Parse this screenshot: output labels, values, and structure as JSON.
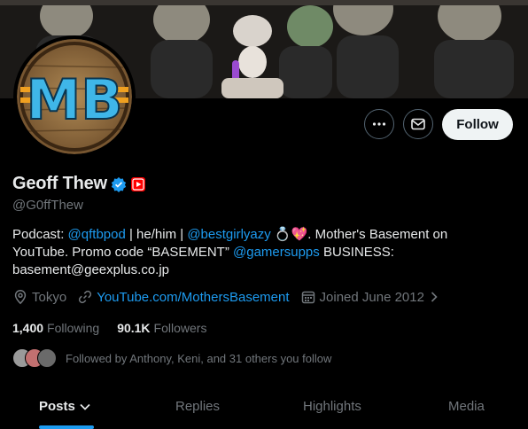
{
  "profile": {
    "display_name": "Geoff Thew",
    "handle": "@G0ffThew",
    "bio": {
      "p1": "Podcast: ",
      "m1": "@qftbpod",
      "p2": " | he/him | ",
      "m2": "@bestgirlyazy",
      "p3": " 💍💖. Mother's Basement on YouTube. Promo code “BASEMENT” ",
      "m3": "@gamersupps",
      "p4": " BUSINESS: basement@geexplus.co.jp"
    },
    "location": "Tokyo",
    "website": "YouTube.com/MothersBasement",
    "joined": "Joined June 2012",
    "following_count": "1,400",
    "following_label": "Following",
    "followers_count": "90.1K",
    "followers_label": "Followers",
    "followed_by": "Followed by Anthony, Keni, and 31 others you follow",
    "avatar_text": "MB"
  },
  "actions": {
    "follow_label": "Follow"
  },
  "tabs": [
    "Posts",
    "Replies",
    "Highlights",
    "Media"
  ],
  "colors": {
    "accent": "#1d9bf0",
    "verified": "#1d9bf0",
    "youtube_badge": "#ff0000",
    "avatar_letters": "#3fb6e8"
  },
  "icons": [
    "more-icon",
    "mail-icon",
    "verified-icon",
    "youtube-badge-icon",
    "location-icon",
    "link-icon",
    "calendar-icon",
    "chevron-right-icon",
    "chevron-down-icon"
  ]
}
